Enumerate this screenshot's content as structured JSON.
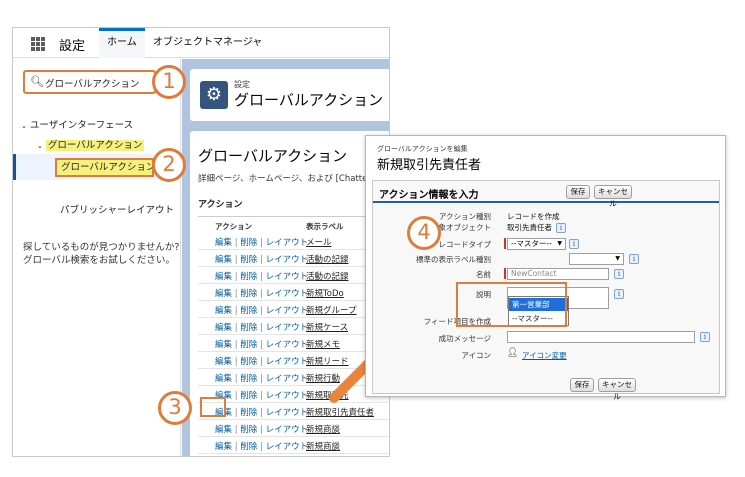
{
  "topbar": {
    "app_name": "設定",
    "tabs": [
      {
        "label": "ホーム"
      },
      {
        "label": "オブジェクトマネージャ"
      }
    ]
  },
  "sidebar": {
    "search_value": "グローバルアクション",
    "tree": [
      {
        "label": "ユーザインターフェース"
      },
      {
        "label": "グローバルアクション"
      },
      {
        "label": "グローバルアクション"
      },
      {
        "label": "パブリッシャーレイアウト"
      }
    ],
    "not_found_line1": "探しているものが見つかりませんか?",
    "not_found_line2": "グローバル検索をお試しください。"
  },
  "main": {
    "header_sub": "設定",
    "header_title": "グローバルアクション",
    "content_title": "グローバルアクション",
    "content_desc": "詳細ページ、ホームページ、および [Chatter] タブで",
    "section_label": "アクション",
    "col_action": "アクション",
    "col_label": "表示ラベル",
    "action_links": {
      "edit": "編集",
      "delete": "削除",
      "layout": "レイアウト",
      "sep": "|"
    },
    "rows": [
      {
        "label": "メール"
      },
      {
        "label": "活動の記録"
      },
      {
        "label": "活動の記録"
      },
      {
        "label": "新規ToDo"
      },
      {
        "label": "新規グループ"
      },
      {
        "label": "新規ケース"
      },
      {
        "label": "新規メモ"
      },
      {
        "label": "新規リード"
      },
      {
        "label": "新規行動"
      },
      {
        "label": "新規取引先"
      },
      {
        "label": "新規取引先責任者"
      },
      {
        "label": "新規商談"
      },
      {
        "label": "新規商談"
      }
    ]
  },
  "steps": [
    "1",
    "2",
    "3",
    "4"
  ],
  "popup": {
    "sub": "グローバルアクションを編集",
    "title": "新規取引先責任者",
    "section_title": "アクション情報を入力",
    "save": "保存",
    "cancel": "キャンセル",
    "fields": {
      "action_type_label": "アクション種別",
      "action_type_value": "レコードを作成",
      "target_obj_label": "対象オブジェクト",
      "target_obj_value": "取引先責任者",
      "record_type_label": "レコードタイプ",
      "record_type_value": "--マスター--",
      "label_type_label": "標準の表示ラベル種別",
      "name_label": "名前",
      "name_value": "NewContact",
      "desc_label": "説明",
      "feed_label": "フィード項目を作成",
      "success_label": "成功メッセージ",
      "icon_label": "アイコン",
      "icon_link": "アイコン変更"
    },
    "dropdown_options": [
      "第一営業部",
      "--マスター--"
    ],
    "info_glyph": "i"
  },
  "colors": {
    "accent_orange": "#e07b39",
    "brand_blue": "#0070d2",
    "highlight_yellow": "#f6f07c",
    "arrow_orange": "#e9843c"
  }
}
